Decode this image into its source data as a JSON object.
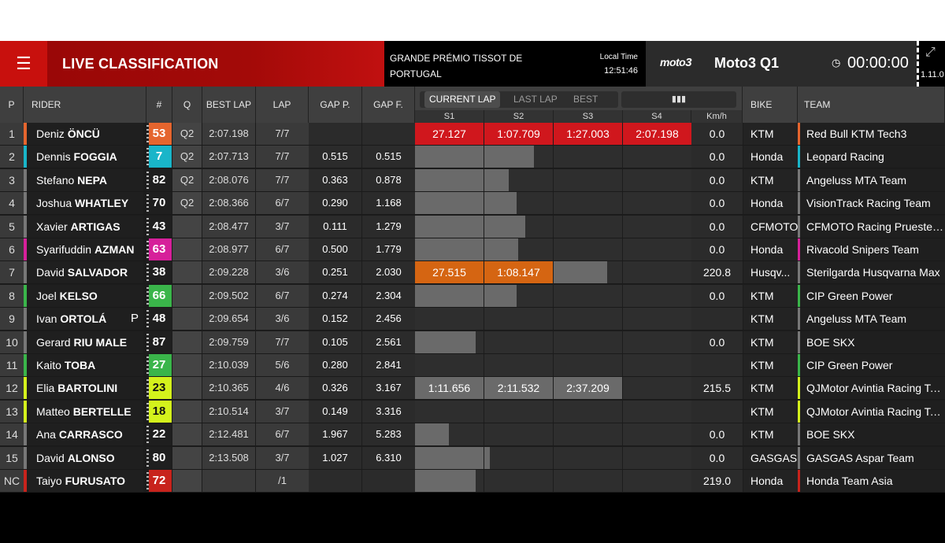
{
  "header": {
    "menu_icon": "hamburger-icon",
    "title": "LIVE CLASSIFICATION",
    "event_name": "GRANDE PRÉMIO TISSOT DE PORTUGAL",
    "local_time_label": "Local Time",
    "local_time": "12:51:46",
    "series_logo": "moto3",
    "session": "Moto3 Q1",
    "clock": "00:00:00",
    "version": "1.11.0",
    "expand_icon": "expand-icon",
    "clock_icon": "clock-icon"
  },
  "columns": {
    "p": "P",
    "rider": "RIDER",
    "num": "#",
    "q": "Q",
    "best": "BEST LAP",
    "lap": "LAP",
    "gapp": "GAP P.",
    "gapf": "GAP F.",
    "s1": "S1",
    "s2": "S2",
    "s3": "S3",
    "s4": "S4",
    "kmh": "Km/h",
    "bike": "BIKE",
    "team": "TEAM"
  },
  "tabs": [
    "CURRENT LAP",
    "LAST LAP",
    "BEST LAP"
  ],
  "active_tab": "CURRENT LAP",
  "signal_icon": "signal-bars-icon",
  "colors": {
    "purple_sector": "#d0171d",
    "orange_sector": "#d56512",
    "grey_bar": "#6a6a6a"
  },
  "rows": [
    {
      "p": "1",
      "first": "Deniz ",
      "last": "ÖNCÜ",
      "pit": "",
      "num": "53",
      "num_bg": "#e5652e",
      "num_fg": "#fff",
      "q": "Q2",
      "best": "2:07.198",
      "lap": "7/7",
      "gapp": "",
      "gapf": "",
      "sectors": [
        {
          "t": "27.127",
          "c": "#d0171d",
          "f": 1
        },
        {
          "t": "1:07.709",
          "c": "#d0171d",
          "f": 1
        },
        {
          "t": "1:27.003",
          "c": "#d0171d",
          "f": 1
        },
        {
          "t": "2:07.198",
          "c": "#d0171d",
          "f": 1
        }
      ],
      "kmh": "0.0",
      "bike": "KTM",
      "team": "Red Bull KTM Tech3",
      "team_color": "#e5652e",
      "rider_color": "#e5652e"
    },
    {
      "p": "2",
      "first": "Dennis ",
      "last": "FOGGIA",
      "pit": "",
      "num": "7",
      "num_bg": "#19b5c9",
      "num_fg": "#fff",
      "q": "Q2",
      "best": "2:07.713",
      "lap": "7/7",
      "gapp": "0.515",
      "gapf": "0.515",
      "sectors": [
        {
          "t": "",
          "c": "#6a6a6a",
          "f": 1
        },
        {
          "t": "",
          "c": "#6a6a6a",
          "f": 0.72
        },
        {
          "t": "",
          "c": "",
          "f": 0
        },
        {
          "t": "",
          "c": "",
          "f": 0
        }
      ],
      "kmh": "0.0",
      "bike": "Honda",
      "team": "Leopard Racing",
      "team_color": "#19b5c9",
      "rider_color": "#19b5c9"
    },
    {
      "p": "3",
      "first": "Stefano ",
      "last": "NEPA",
      "pit": "",
      "num": "82",
      "num_bg": "#1f1f1f",
      "num_fg": "#fff",
      "q": "Q2",
      "best": "2:08.076",
      "lap": "7/7",
      "gapp": "0.363",
      "gapf": "0.878",
      "sectors": [
        {
          "t": "",
          "c": "#6a6a6a",
          "f": 1
        },
        {
          "t": "",
          "c": "#6a6a6a",
          "f": 0.36
        },
        {
          "t": "",
          "c": "",
          "f": 0
        },
        {
          "t": "",
          "c": "",
          "f": 0
        }
      ],
      "kmh": "0.0",
      "bike": "KTM",
      "team": "Angeluss MTA Team",
      "team_color": "#777",
      "rider_color": ""
    },
    {
      "p": "4",
      "first": "Joshua ",
      "last": "WHATLEY",
      "pit": "",
      "num": "70",
      "num_bg": "#1f1f1f",
      "num_fg": "#fff",
      "q": "Q2",
      "best": "2:08.366",
      "lap": "6/7",
      "gapp": "0.290",
      "gapf": "1.168",
      "sectors": [
        {
          "t": "",
          "c": "#6a6a6a",
          "f": 1
        },
        {
          "t": "",
          "c": "#6a6a6a",
          "f": 0.47
        },
        {
          "t": "",
          "c": "",
          "f": 0
        },
        {
          "t": "",
          "c": "",
          "f": 0
        }
      ],
      "kmh": "0.0",
      "bike": "Honda",
      "team": "VisionTrack Racing Team",
      "team_color": "#777",
      "rider_color": ""
    },
    {
      "p": "5",
      "first": "Xavier ",
      "last": "ARTIGAS",
      "pit": "",
      "num": "43",
      "num_bg": "#1f1f1f",
      "num_fg": "#fff",
      "q": "",
      "best": "2:08.477",
      "lap": "3/7",
      "gapp": "0.111",
      "gapf": "1.279",
      "sectors": [
        {
          "t": "",
          "c": "#6a6a6a",
          "f": 1
        },
        {
          "t": "",
          "c": "#6a6a6a",
          "f": 0.6
        },
        {
          "t": "",
          "c": "",
          "f": 0
        },
        {
          "t": "",
          "c": "",
          "f": 0
        }
      ],
      "kmh": "0.0",
      "bike": "CFMOTO",
      "team": "CFMOTO Racing PruestelGP",
      "team_color": "#777",
      "rider_color": ""
    },
    {
      "p": "6",
      "first": "Syarifuddin ",
      "last": "AZMAN",
      "pit": "",
      "num": "63",
      "num_bg": "#d6209a",
      "num_fg": "#fff",
      "q": "",
      "best": "2:08.977",
      "lap": "6/7",
      "gapp": "0.500",
      "gapf": "1.779",
      "sectors": [
        {
          "t": "",
          "c": "#6a6a6a",
          "f": 1
        },
        {
          "t": "",
          "c": "#6a6a6a",
          "f": 0.49
        },
        {
          "t": "",
          "c": "",
          "f": 0
        },
        {
          "t": "",
          "c": "",
          "f": 0
        }
      ],
      "kmh": "0.0",
      "bike": "Honda",
      "team": "Rivacold Snipers Team",
      "team_color": "#d6209a",
      "rider_color": "#d6209a"
    },
    {
      "p": "7",
      "first": "David ",
      "last": "SALVADOR",
      "pit": "",
      "num": "38",
      "num_bg": "#1f1f1f",
      "num_fg": "#fff",
      "q": "",
      "best": "2:09.228",
      "lap": "3/6",
      "gapp": "0.251",
      "gapf": "2.030",
      "sectors": [
        {
          "t": "27.515",
          "c": "#d56512",
          "f": 1
        },
        {
          "t": "1:08.147",
          "c": "#d56512",
          "f": 1
        },
        {
          "t": "",
          "c": "#6a6a6a",
          "f": 0.78
        },
        {
          "t": "",
          "c": "",
          "f": 0
        }
      ],
      "kmh": "220.8",
      "bike": "Husqv...",
      "team": "Sterilgarda Husqvarna Max",
      "team_color": "#777",
      "rider_color": ""
    },
    {
      "p": "8",
      "first": "Joel ",
      "last": "KELSO",
      "pit": "",
      "num": "66",
      "num_bg": "#3ab54a",
      "num_fg": "#fff",
      "q": "",
      "best": "2:09.502",
      "lap": "6/7",
      "gapp": "0.274",
      "gapf": "2.304",
      "sectors": [
        {
          "t": "",
          "c": "#6a6a6a",
          "f": 1
        },
        {
          "t": "",
          "c": "#6a6a6a",
          "f": 0.47
        },
        {
          "t": "",
          "c": "",
          "f": 0
        },
        {
          "t": "",
          "c": "",
          "f": 0
        }
      ],
      "kmh": "0.0",
      "bike": "KTM",
      "team": "CIP Green Power",
      "team_color": "#3ab54a",
      "rider_color": ""
    },
    {
      "p": "9",
      "first": "Ivan ",
      "last": "ORTOLÁ",
      "pit": "P",
      "num": "48",
      "num_bg": "#1f1f1f",
      "num_fg": "#fff",
      "q": "",
      "best": "2:09.654",
      "lap": "3/6",
      "gapp": "0.152",
      "gapf": "2.456",
      "sectors": [
        {
          "t": "",
          "c": "",
          "f": 0
        },
        {
          "t": "",
          "c": "",
          "f": 0
        },
        {
          "t": "",
          "c": "",
          "f": 0
        },
        {
          "t": "",
          "c": "",
          "f": 0
        }
      ],
      "kmh": "",
      "bike": "KTM",
      "team": "Angeluss MTA Team",
      "team_color": "#777",
      "rider_color": ""
    },
    {
      "p": "10",
      "first": "Gerard ",
      "last": "RIU MALE",
      "pit": "",
      "num": "87",
      "num_bg": "#1f1f1f",
      "num_fg": "#fff",
      "q": "",
      "best": "2:09.759",
      "lap": "7/7",
      "gapp": "0.105",
      "gapf": "2.561",
      "sectors": [
        {
          "t": "",
          "c": "#6a6a6a",
          "f": 0.88
        },
        {
          "t": "",
          "c": "",
          "f": 0
        },
        {
          "t": "",
          "c": "",
          "f": 0
        },
        {
          "t": "",
          "c": "",
          "f": 0
        }
      ],
      "kmh": "0.0",
      "bike": "KTM",
      "team": "BOE SKX",
      "team_color": "#777",
      "rider_color": ""
    },
    {
      "p": "11",
      "first": "Kaito ",
      "last": "TOBA",
      "pit": "",
      "num": "27",
      "num_bg": "#3ab54a",
      "num_fg": "#fff",
      "q": "",
      "best": "2:10.039",
      "lap": "5/6",
      "gapp": "0.280",
      "gapf": "2.841",
      "sectors": [
        {
          "t": "",
          "c": "",
          "f": 0
        },
        {
          "t": "",
          "c": "",
          "f": 0
        },
        {
          "t": "",
          "c": "",
          "f": 0
        },
        {
          "t": "",
          "c": "",
          "f": 0
        }
      ],
      "kmh": "",
      "bike": "KTM",
      "team": "CIP Green Power",
      "team_color": "#3ab54a",
      "rider_color": ""
    },
    {
      "p": "12",
      "first": "Elia ",
      "last": "BARTOLINI",
      "pit": "",
      "num": "23",
      "num_bg": "#d4f21c",
      "num_fg": "#111",
      "q": "",
      "best": "2:10.365",
      "lap": "4/6",
      "gapp": "0.326",
      "gapf": "3.167",
      "sectors": [
        {
          "t": "1:11.656",
          "c": "#6a6a6a",
          "f": 1
        },
        {
          "t": "2:11.532",
          "c": "#6a6a6a",
          "f": 1
        },
        {
          "t": "2:37.209",
          "c": "#6a6a6a",
          "f": 1
        },
        {
          "t": "",
          "c": "",
          "f": 0
        }
      ],
      "kmh": "215.5",
      "bike": "KTM",
      "team": "QJMotor Avintia Racing Te...",
      "team_color": "#d4f21c",
      "rider_color": ""
    },
    {
      "p": "13",
      "first": "Matteo ",
      "last": "BERTELLE",
      "pit": "",
      "num": "18",
      "num_bg": "#d4f21c",
      "num_fg": "#111",
      "q": "",
      "best": "2:10.514",
      "lap": "3/7",
      "gapp": "0.149",
      "gapf": "3.316",
      "sectors": [
        {
          "t": "",
          "c": "",
          "f": 0
        },
        {
          "t": "",
          "c": "",
          "f": 0
        },
        {
          "t": "",
          "c": "",
          "f": 0
        },
        {
          "t": "",
          "c": "",
          "f": 0
        }
      ],
      "kmh": "",
      "bike": "KTM",
      "team": "QJMotor Avintia Racing Te...",
      "team_color": "#d4f21c",
      "rider_color": ""
    },
    {
      "p": "14",
      "first": "Ana ",
      "last": "CARRASCO",
      "pit": "",
      "num": "22",
      "num_bg": "#1f1f1f",
      "num_fg": "#fff",
      "q": "",
      "best": "2:12.481",
      "lap": "6/7",
      "gapp": "1.967",
      "gapf": "5.283",
      "sectors": [
        {
          "t": "",
          "c": "#6a6a6a",
          "f": 0.49
        },
        {
          "t": "",
          "c": "",
          "f": 0
        },
        {
          "t": "",
          "c": "",
          "f": 0
        },
        {
          "t": "",
          "c": "",
          "f": 0
        }
      ],
      "kmh": "0.0",
      "bike": "KTM",
      "team": "BOE SKX",
      "team_color": "#777",
      "rider_color": ""
    },
    {
      "p": "15",
      "first": "David ",
      "last": "ALONSO",
      "pit": "",
      "num": "80",
      "num_bg": "#1f1f1f",
      "num_fg": "#fff",
      "q": "",
      "best": "2:13.508",
      "lap": "3/7",
      "gapp": "1.027",
      "gapf": "6.310",
      "sectors": [
        {
          "t": "",
          "c": "#6a6a6a",
          "f": 1
        },
        {
          "t": "",
          "c": "#6a6a6a",
          "f": 0.08
        },
        {
          "t": "",
          "c": "",
          "f": 0
        },
        {
          "t": "",
          "c": "",
          "f": 0
        }
      ],
      "kmh": "0.0",
      "bike": "GASGAS",
      "team": "GASGAS Aspar Team",
      "team_color": "#777",
      "rider_color": ""
    },
    {
      "p": "NC",
      "first": "Taiyo ",
      "last": "FURUSATO",
      "pit": "",
      "num": "72",
      "num_bg": "#c8231c",
      "num_fg": "#fff",
      "q": "",
      "best": "",
      "lap": "/1",
      "gapp": "",
      "gapf": "",
      "sectors": [
        {
          "t": "",
          "c": "#6a6a6a",
          "f": 0.88
        },
        {
          "t": "",
          "c": "",
          "f": 0
        },
        {
          "t": "",
          "c": "",
          "f": 0
        },
        {
          "t": "",
          "c": "",
          "f": 0
        }
      ],
      "kmh": "219.0",
      "bike": "Honda",
      "team": "Honda Team Asia",
      "team_color": "#c8231c",
      "rider_color": ""
    }
  ]
}
